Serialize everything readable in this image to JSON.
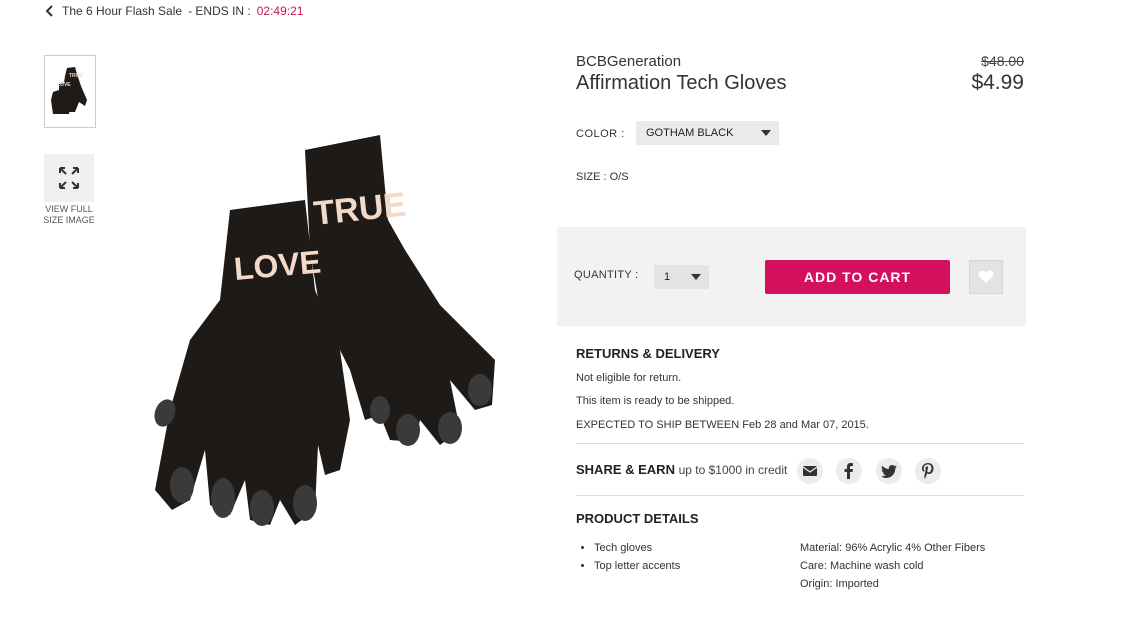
{
  "breadcrumb": {
    "back_label": "The 6 Hour Flash Sale",
    "ends_label": "- ENDS IN :",
    "timer": "02:49:21"
  },
  "gallery": {
    "view_full_label_line1": "VIEW FULL",
    "view_full_label_line2": "SIZE IMAGE",
    "glove_text_left": "LOVE",
    "glove_text_right": "TRUE"
  },
  "product": {
    "brand": "BCBGeneration",
    "name": "Affirmation Tech Gloves",
    "original_price": "$48.00",
    "sale_price": "$4.99",
    "color_label": "COLOR :",
    "color_value": "GOTHAM BLACK",
    "size_label": "SIZE : O/S"
  },
  "cart": {
    "quantity_label": "QUANTITY :",
    "quantity_value": "1",
    "add_to_cart_label": "ADD TO CART"
  },
  "returns": {
    "heading": "RETURNS & DELIVERY",
    "lines": [
      "Not eligible for return.",
      "This item is ready to be shipped.",
      "EXPECTED TO SHIP BETWEEN Feb 28 and Mar 07, 2015."
    ]
  },
  "share": {
    "heading": "SHARE & EARN",
    "subtext": "up to $1000 in credit"
  },
  "details": {
    "heading": "PRODUCT DETAILS",
    "bullets": [
      "Tech gloves",
      "Top letter accents"
    ],
    "specs": [
      "Material: 96% Acrylic 4% Other Fibers",
      "Care: Machine wash cold",
      "Origin: Imported"
    ]
  },
  "colors": {
    "accent": "#d4105e",
    "timer": "#c0185a"
  }
}
